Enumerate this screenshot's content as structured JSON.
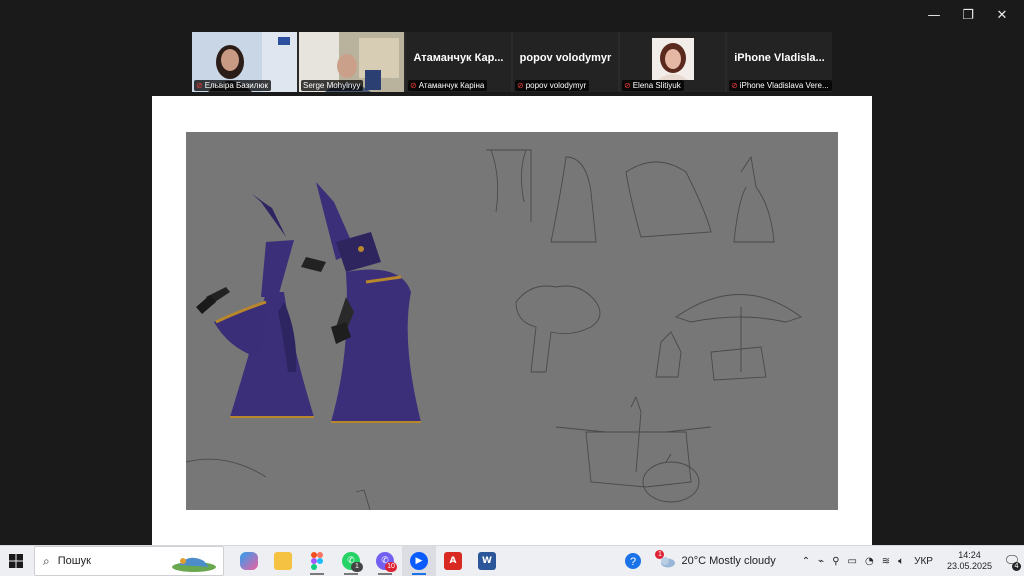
{
  "window_controls": {
    "minimize": "—",
    "restore": "❐",
    "close": "✕"
  },
  "participants": [
    {
      "display": "",
      "label": "Ельвіра Базилюк",
      "muted": true,
      "video": "elvira",
      "active": false
    },
    {
      "display": "",
      "label": "Serge Mohylnyy",
      "muted": false,
      "video": "serge",
      "active": true
    },
    {
      "display": "Атаманчук Кар...",
      "label": "Атаманчук Каріна",
      "muted": true,
      "video": "",
      "active": false
    },
    {
      "display": "popov volodymyr",
      "label": "popov volodymyr",
      "muted": true,
      "video": "",
      "active": false
    },
    {
      "display": "",
      "label": "Elena Slitiyuk",
      "muted": true,
      "video": "elena",
      "active": false
    },
    {
      "display": "iPhone Vladisla...",
      "label": "iPhone Vladislava Vere...",
      "muted": true,
      "video": "",
      "active": false
    }
  ],
  "taskbar": {
    "search_placeholder": "Пошук",
    "apps": [
      {
        "name": "copilot",
        "badge": ""
      },
      {
        "name": "file-explorer",
        "badge": ""
      },
      {
        "name": "figma",
        "badge": ""
      },
      {
        "name": "whatsapp",
        "badge": "1"
      },
      {
        "name": "viber",
        "badge": "10"
      },
      {
        "name": "zoom",
        "badge": ""
      },
      {
        "name": "acrobat",
        "badge": ""
      },
      {
        "name": "word",
        "badge": ""
      }
    ],
    "weather": "20°C  Mostly cloudy",
    "language": "УКР",
    "time": "14:24",
    "date": "23.05.2025",
    "notifications": "4"
  },
  "colors": {
    "zoom_active": "#23d160",
    "artwork_bg": "#777777",
    "character_purple": "#3b2f7a",
    "trim_gold": "#b8862b"
  }
}
